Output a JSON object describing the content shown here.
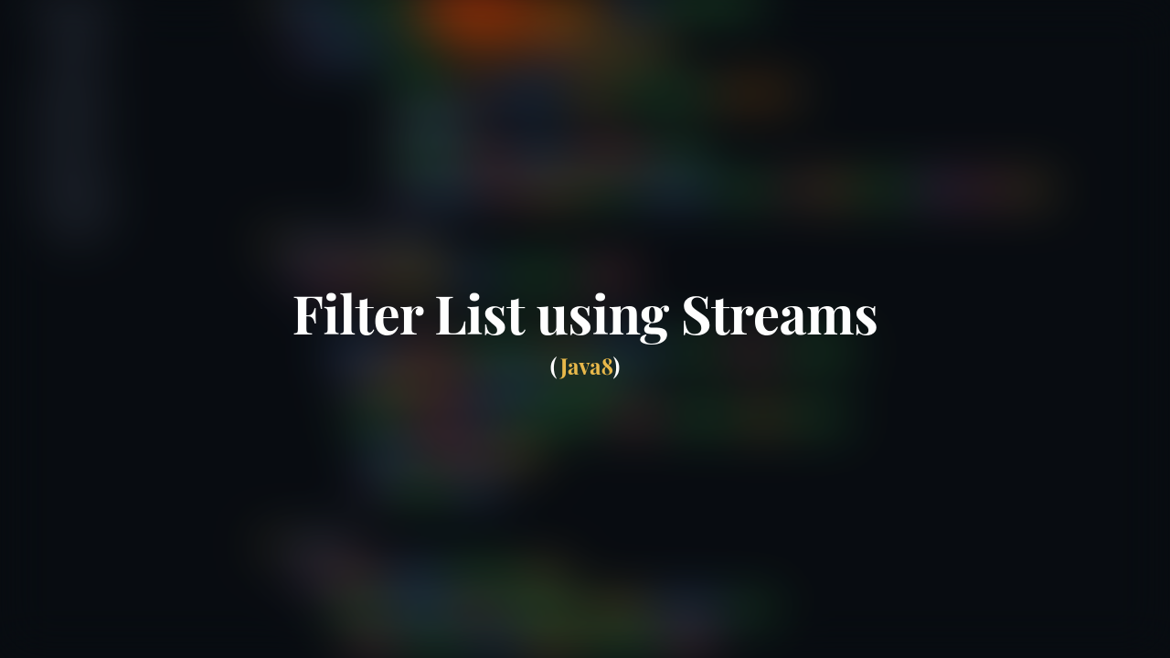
{
  "title": "Filter List using Streams",
  "subtitle": {
    "open_paren": "(",
    "tech": "Java8",
    "close_paren": ")"
  },
  "colors": {
    "title": "#fefefe",
    "accent": "#e8b84a",
    "background": "#0a0e14"
  }
}
